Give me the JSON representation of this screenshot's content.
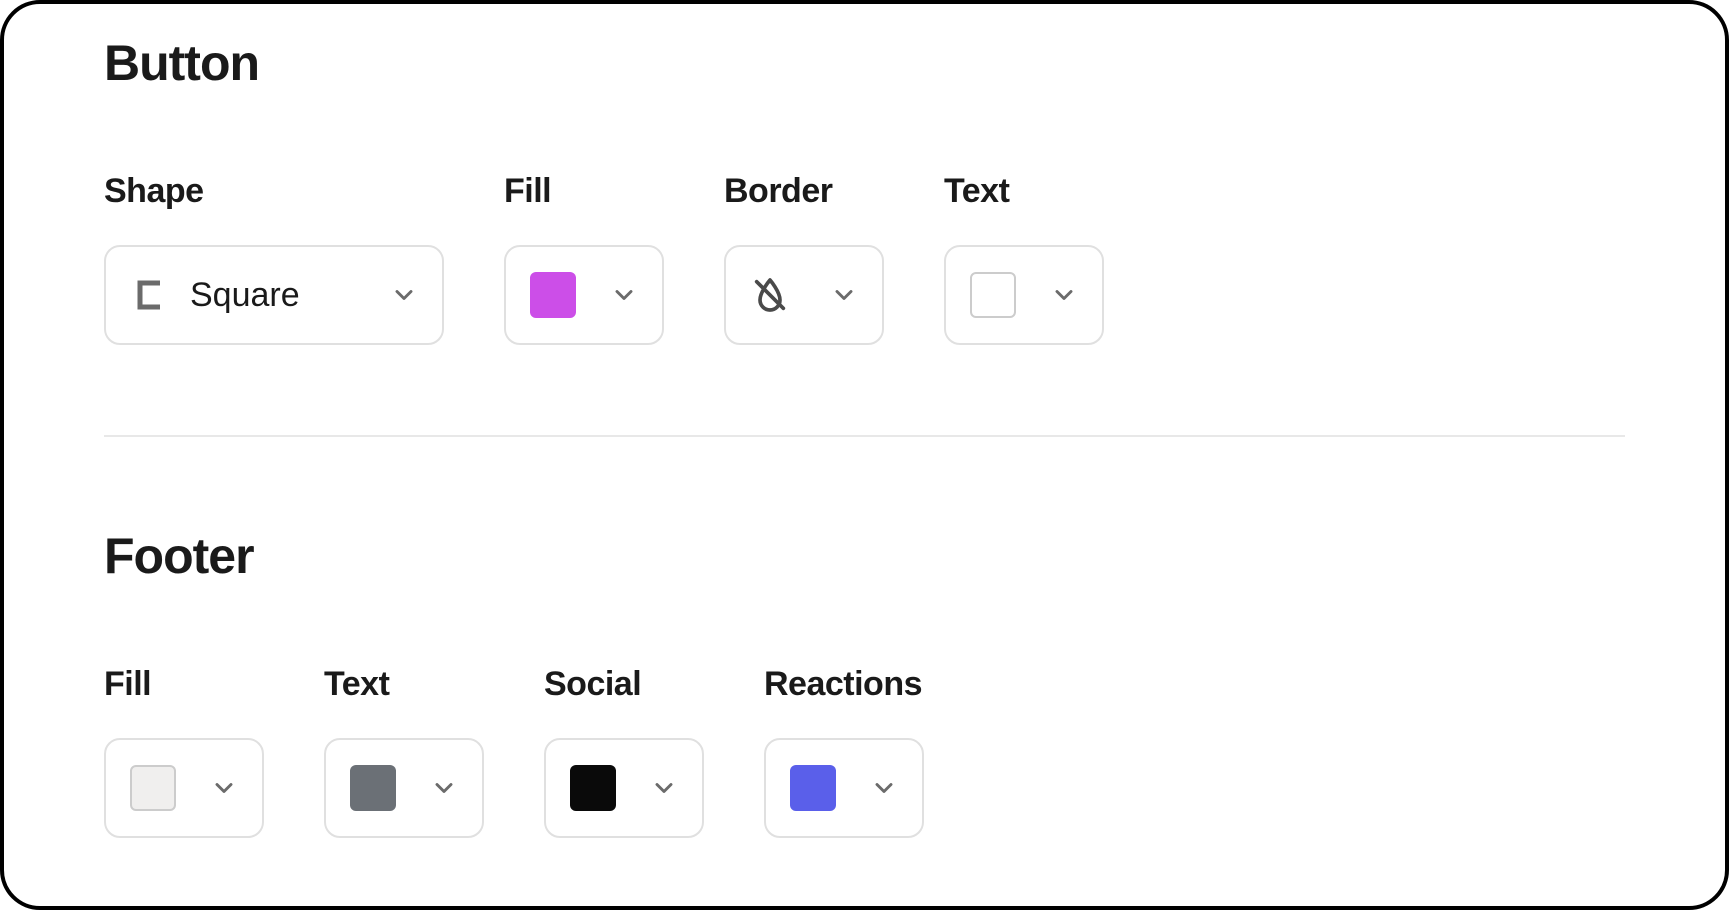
{
  "button": {
    "title": "Button",
    "shape": {
      "label": "Shape",
      "value": "Square"
    },
    "fill": {
      "label": "Fill",
      "color": "#CC4EE8"
    },
    "border": {
      "label": "Border",
      "value": "none"
    },
    "text": {
      "label": "Text",
      "color": "#FFFFFF"
    }
  },
  "footer": {
    "title": "Footer",
    "fill": {
      "label": "Fill",
      "color": "#F0EFEE"
    },
    "text": {
      "label": "Text",
      "color": "#6B7076"
    },
    "social": {
      "label": "Social",
      "color": "#0A0A0A"
    },
    "reactions": {
      "label": "Reactions",
      "color": "#5A5FEA"
    }
  }
}
